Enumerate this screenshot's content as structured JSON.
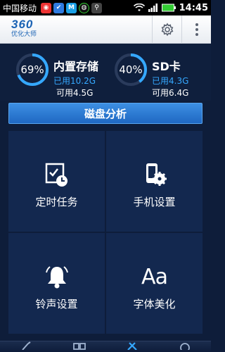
{
  "status_bar": {
    "carrier": "中国移动",
    "time": "14:45"
  },
  "header": {
    "logo_main": "360",
    "logo_sub": "优化大师"
  },
  "storage": {
    "internal": {
      "percent": "69%",
      "title": "内置存储",
      "used": "已用10.2G",
      "free": "可用4.5G",
      "fraction": 0.69
    },
    "sd": {
      "percent": "40%",
      "title": "SD卡",
      "used": "已用4.3G",
      "free": "可用6.4G",
      "fraction": 0.4
    }
  },
  "analyze_label": "磁盘分析",
  "tiles": [
    {
      "label": "定时任务",
      "icon": "scheduled-task-icon"
    },
    {
      "label": "手机设置",
      "icon": "phone-settings-icon"
    },
    {
      "label": "铃声设置",
      "icon": "bell-icon"
    },
    {
      "label": "字体美化",
      "icon": "font-icon",
      "glyph": "Aa"
    }
  ],
  "colors": {
    "accent": "#35a8ff",
    "ring_track": "#2a3b5c",
    "tile_bg": "#13284f"
  }
}
